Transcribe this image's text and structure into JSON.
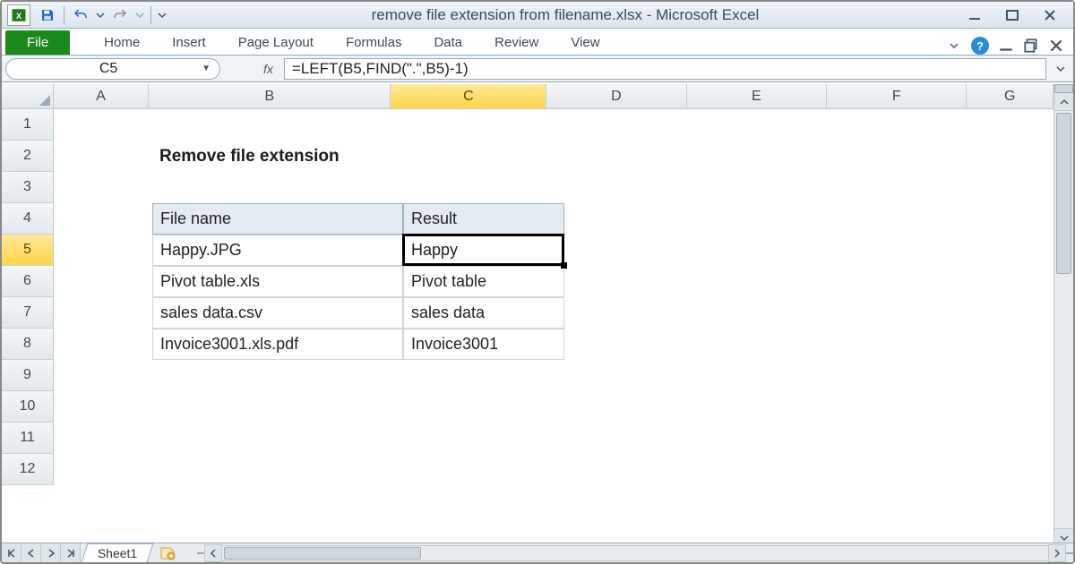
{
  "window": {
    "title": "remove file extension from filename.xlsx  -  Microsoft Excel"
  },
  "ribbon": {
    "file": "File",
    "tabs": [
      "Home",
      "Insert",
      "Page Layout",
      "Formulas",
      "Data",
      "Review",
      "View"
    ]
  },
  "namebox": "C5",
  "formula": "=LEFT(B5,FIND(\".\",B5)-1)",
  "fx_label": "fx",
  "columns": [
    "A",
    "B",
    "C",
    "D",
    "E",
    "F",
    "G"
  ],
  "selected_col": 2,
  "row_count": 12,
  "selected_row": 5,
  "heading": "Remove file extension",
  "table": {
    "headers": [
      "File name",
      "Result"
    ],
    "rows": [
      [
        "Happy.JPG",
        "Happy"
      ],
      [
        "Pivot table.xls",
        "Pivot table"
      ],
      [
        "sales data.csv",
        "sales data"
      ],
      [
        "Invoice3001.xls.pdf",
        "Invoice3001"
      ]
    ]
  },
  "sheet_tab": "Sheet1"
}
